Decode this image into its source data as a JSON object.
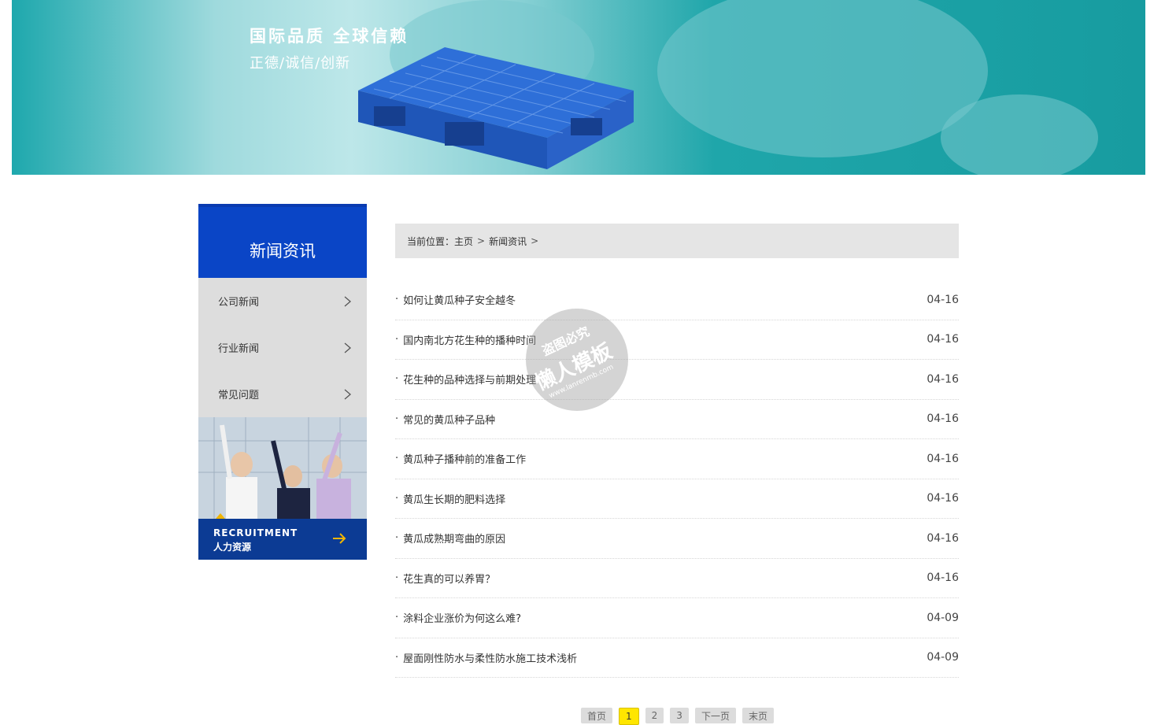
{
  "banner": {
    "title": "国际品质 全球信赖",
    "subtitle": "正德/诚信/创新"
  },
  "sidebar": {
    "heading": "新闻资讯",
    "items": [
      {
        "label": "公司新闻"
      },
      {
        "label": "行业新闻"
      },
      {
        "label": "常见问题"
      }
    ],
    "recruit": {
      "en": "RECRUITMENT",
      "cn": "人力资源"
    }
  },
  "breadcrumb": {
    "prefix": "当前位置：",
    "home": "主页",
    "sep1": ">",
    "current": "新闻资讯",
    "sep2": ">"
  },
  "news": [
    {
      "title": "如何让黄瓜种子安全越冬",
      "date": "04-16"
    },
    {
      "title": "国内南北方花生种的播种时间",
      "date": "04-16"
    },
    {
      "title": "花生种的品种选择与前期处理",
      "date": "04-16"
    },
    {
      "title": "常见的黄瓜种子品种",
      "date": "04-16"
    },
    {
      "title": "黄瓜种子播种前的准备工作",
      "date": "04-16"
    },
    {
      "title": "黄瓜生长期的肥料选择",
      "date": "04-16"
    },
    {
      "title": "黄瓜成熟期弯曲的原因",
      "date": "04-16"
    },
    {
      "title": "花生真的可以养胃？",
      "date": "04-16"
    },
    {
      "title": "涂料企业涨价为何这么难?",
      "date": "04-09"
    },
    {
      "title": "屋面刚性防水与柔性防水施工技术浅析",
      "date": "04-09"
    }
  ],
  "pager": {
    "first": "首页",
    "p1": "1",
    "p2": "2",
    "p3": "3",
    "next": "下一页",
    "last": "末页"
  },
  "watermark": {
    "line1": "盗图必究",
    "line2": "懒人模板",
    "line3": "www.lanrenmb.com"
  }
}
